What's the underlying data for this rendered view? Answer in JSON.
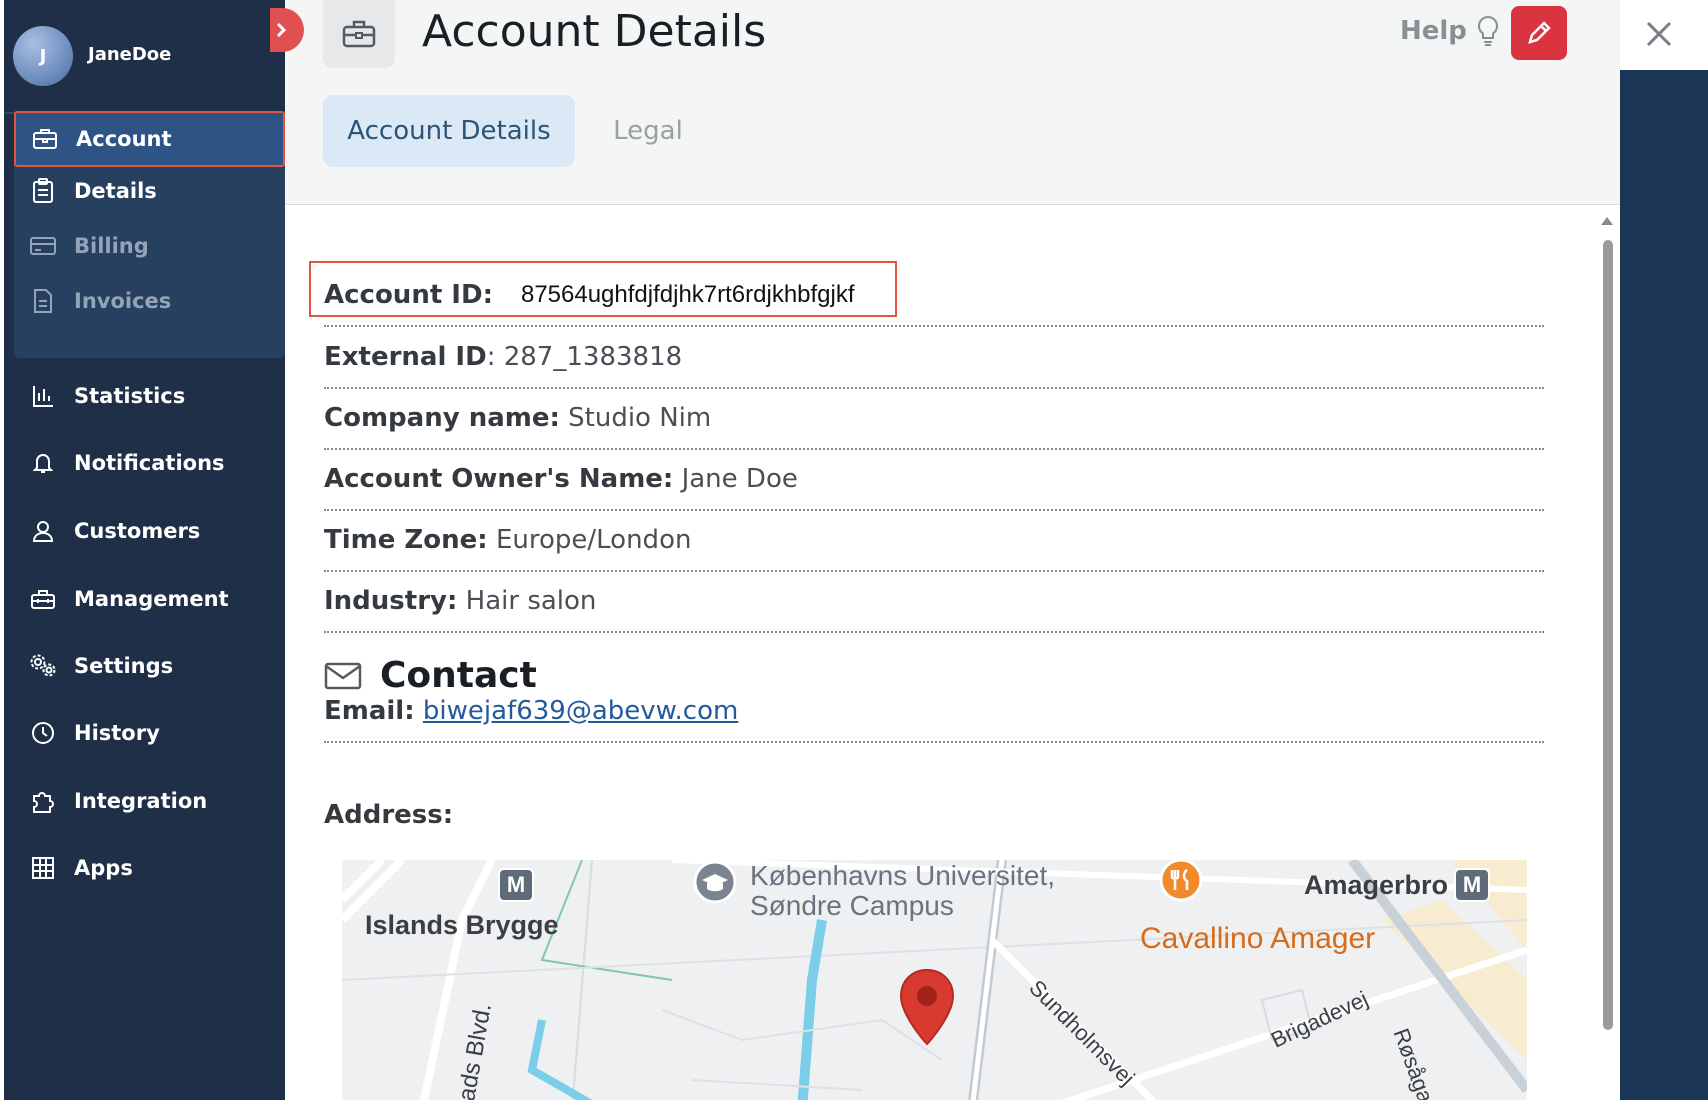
{
  "user": {
    "initial": "J",
    "name": "JaneDoe"
  },
  "sidebar": {
    "items": [
      {
        "label": "Account",
        "icon": "briefcase-icon",
        "state": "active"
      },
      {
        "label": "Details",
        "icon": "clipboard-icon",
        "state": "sub"
      },
      {
        "label": "Billing",
        "icon": "credit-card-icon",
        "state": "dim"
      },
      {
        "label": "Invoices",
        "icon": "document-icon",
        "state": "dim"
      },
      {
        "label": "Statistics",
        "icon": "bar-chart-icon"
      },
      {
        "label": "Notifications",
        "icon": "bell-icon"
      },
      {
        "label": "Customers",
        "icon": "user-icon"
      },
      {
        "label": "Management",
        "icon": "toolbox-icon"
      },
      {
        "label": "Settings",
        "icon": "gears-icon"
      },
      {
        "label": "History",
        "icon": "clock-icon"
      },
      {
        "label": "Integration",
        "icon": "puzzle-icon"
      },
      {
        "label": "Apps",
        "icon": "grid-icon"
      }
    ]
  },
  "header": {
    "title": "Account Details",
    "help_label": "Help",
    "tabs": [
      {
        "label": "Account Details",
        "active": true
      },
      {
        "label": "Legal",
        "active": false
      }
    ]
  },
  "details": {
    "account_id": {
      "label": "Account ID:",
      "value": "87564ughfdjfdjhk7rt6rdjkhbfgjkf"
    },
    "external_id": {
      "label": "External ID",
      "value": ": 287_1383818"
    },
    "company_name": {
      "label": "Company name:",
      "value": "Studio Nim"
    },
    "owner_name": {
      "label": "Account Owner's Name:",
      "value": "Jane Doe"
    },
    "time_zone": {
      "label": "Time Zone:",
      "value": "Europe/London"
    },
    "industry": {
      "label": "Industry:",
      "value": "Hair salon"
    }
  },
  "contact": {
    "title": "Contact",
    "email_label": "Email:",
    "email": "biwejaf639@abevw.com",
    "address_label": "Address:"
  },
  "map": {
    "labels": {
      "islands_brygge": "Islands Brygge",
      "university_1": "Københavns Universitet,",
      "university_2": "Søndre Campus",
      "amagerbro": "Amagerbro",
      "cavallino": "Cavallino Amager",
      "sundholmsvej": "Sundholmsvej",
      "brigadevej": "Brigadevej",
      "rosagade": "Røsåga",
      "blvd": "tads Blvd.",
      "metro": "M"
    },
    "colors": {
      "marker": "#d93a2f",
      "restaurant": "#d86b1a",
      "water": "#7ccdea"
    }
  },
  "colors": {
    "sidebar": "#1e2f47",
    "highlight": "#e2553d",
    "edit": "#d9343f",
    "link": "#245a9c"
  }
}
